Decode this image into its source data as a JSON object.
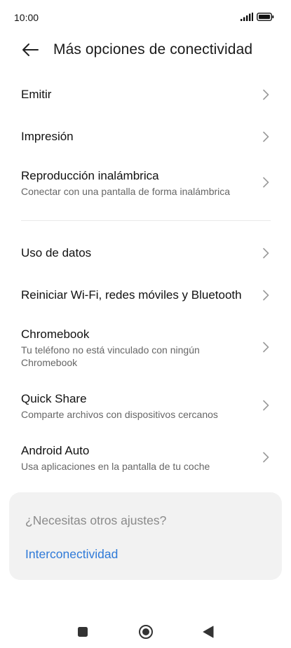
{
  "status_bar": {
    "time": "10:00",
    "icons": [
      "signal-icon",
      "battery-icon"
    ]
  },
  "header": {
    "title": "Más opciones de conectividad",
    "back_icon": "arrow-left-icon"
  },
  "items": [
    {
      "title": "Emitir",
      "subtitle": ""
    },
    {
      "title": "Impresión",
      "subtitle": ""
    },
    {
      "title": "Reproducción inalámbrica",
      "subtitle": "Conectar con una pantalla de forma inalámbrica"
    },
    {
      "title": "Uso de datos",
      "subtitle": ""
    },
    {
      "title": "Reiniciar Wi-Fi, redes móviles y Bluetooth",
      "subtitle": ""
    },
    {
      "title": "Chromebook",
      "subtitle": "Tu teléfono no está vinculado con ningún Chromebook"
    },
    {
      "title": "Quick Share",
      "subtitle": "Comparte archivos con dispositivos cercanos"
    },
    {
      "title": "Android Auto",
      "subtitle": "Usa aplicaciones en la pantalla de tu coche"
    }
  ],
  "card": {
    "title": "¿Necesitas otros ajustes?",
    "link": "Interconectividad"
  },
  "nav_bar": {
    "buttons": [
      "recents-square-icon",
      "home-circle-icon",
      "back-triangle-icon"
    ]
  },
  "colors": {
    "link": "#2f7ad8",
    "card_bg": "#f2f2f2",
    "subtitle": "#666666",
    "chevron": "#9a9a9a"
  }
}
